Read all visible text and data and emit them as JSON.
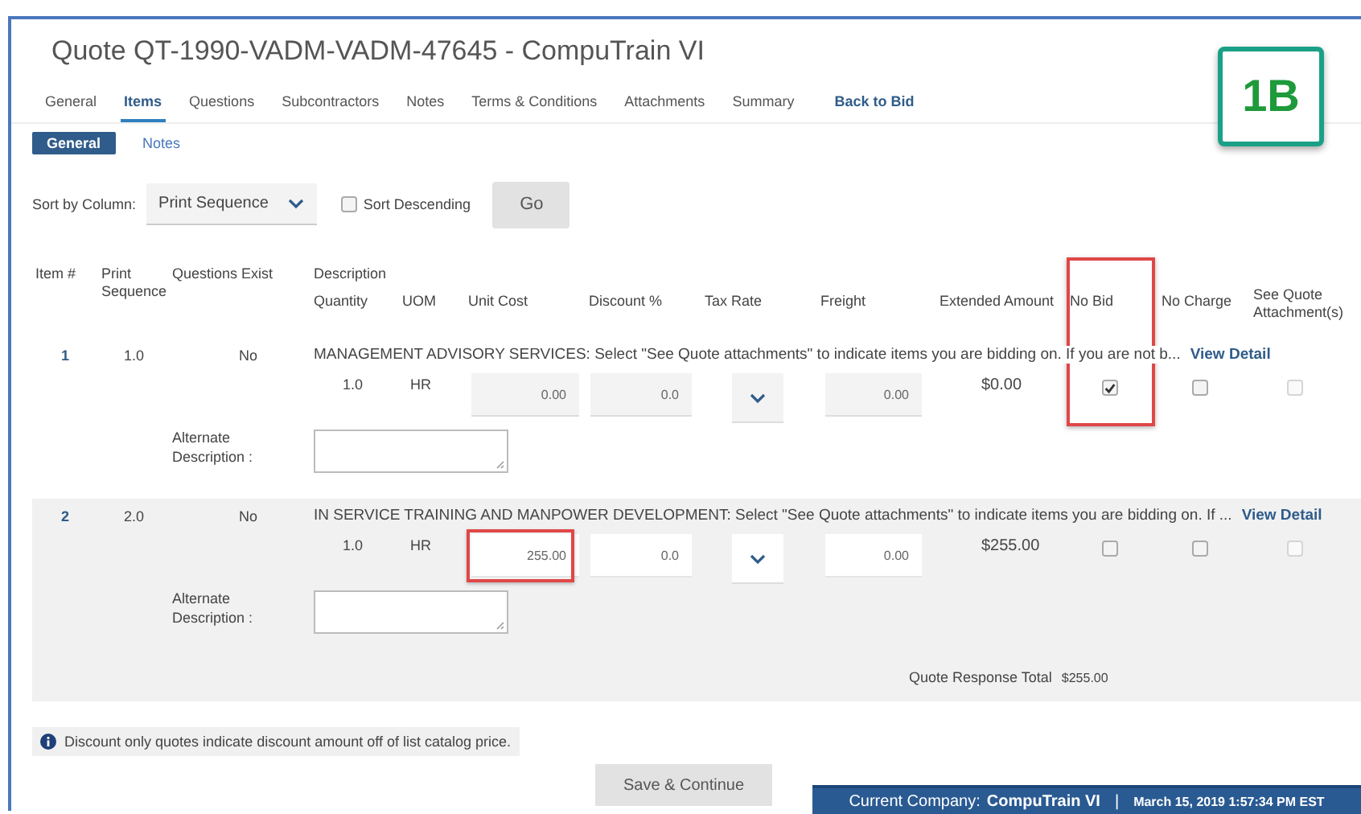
{
  "title": "Quote QT-1990-VADM-VADM-47645 - CompuTrain VI",
  "tabs": [
    {
      "label": "General",
      "selected": false,
      "kind": "tab"
    },
    {
      "label": "Items",
      "selected": true,
      "kind": "tab"
    },
    {
      "label": "Questions",
      "selected": false,
      "kind": "tab"
    },
    {
      "label": "Subcontractors",
      "selected": false,
      "kind": "tab"
    },
    {
      "label": "Notes",
      "selected": false,
      "kind": "tab"
    },
    {
      "label": "Terms & Conditions",
      "selected": false,
      "kind": "tab"
    },
    {
      "label": "Attachments",
      "selected": false,
      "kind": "tab"
    },
    {
      "label": "Summary",
      "selected": false,
      "kind": "tab"
    },
    {
      "label": "Back to Bid",
      "selected": false,
      "kind": "link"
    }
  ],
  "subtabs": [
    {
      "label": "General",
      "selected": true
    },
    {
      "label": "Notes",
      "selected": false
    }
  ],
  "sort": {
    "label": "Sort by Column:",
    "value": "Print Sequence",
    "descending_label": "Sort Descending",
    "descending": false,
    "go": "Go"
  },
  "columns": {
    "item": "Item #",
    "sequence": "Print Sequence",
    "questions": "Questions Exist",
    "description": "Description",
    "quantity": "Quantity",
    "uom": "UOM",
    "unit_cost": "Unit Cost",
    "discount": "Discount %",
    "tax": "Tax Rate",
    "freight": "Freight",
    "extended": "Extended Amount",
    "no_bid": "No Bid",
    "no_charge": "No Charge",
    "see_quote": "See Quote Attachment(s)"
  },
  "items": [
    {
      "number": "1",
      "sequence": "1.0",
      "questions": "No",
      "description": "MANAGEMENT ADVISORY SERVICES: Select \"See Quote attachments\" to indicate items you are bidding on. If you are not b...",
      "link": "View Detail",
      "quantity": "1.0",
      "uom": "HR",
      "unit_cost": "0.00",
      "discount": "0.0",
      "freight": "0.00",
      "extended": "$0.00",
      "no_bid": true,
      "no_charge": false,
      "see_quote": false,
      "see_quote_disabled": true,
      "alt_label": "Alternate Description :",
      "shaded": false,
      "unit_cost_boxed": false
    },
    {
      "number": "2",
      "sequence": "2.0",
      "questions": "No",
      "description": "IN SERVICE TRAINING AND MANPOWER DEVELOPMENT: Select \"See Quote attachments\" to indicate items you are bidding on. If ...",
      "link": "View Detail",
      "quantity": "1.0",
      "uom": "HR",
      "unit_cost": "255.00",
      "discount": "0.0",
      "freight": "0.00",
      "extended": "$255.00",
      "no_bid": false,
      "no_charge": false,
      "see_quote": false,
      "see_quote_disabled": true,
      "alt_label": "Alternate Description :",
      "shaded": true,
      "unit_cost_boxed": true
    }
  ],
  "total": {
    "label": "Quote Response Total",
    "value": "$255.00"
  },
  "note": "Discount only quotes indicate discount amount off of list catalog price.",
  "save": "Save & Continue",
  "status": {
    "company_label": "Current Company:",
    "company": "CompuTrain VI",
    "separator": "|",
    "datetime": "March 15, 2019 1:57:34 PM EST"
  },
  "annotations": {
    "badge": "1B",
    "no_bid_column_boxed": true
  }
}
